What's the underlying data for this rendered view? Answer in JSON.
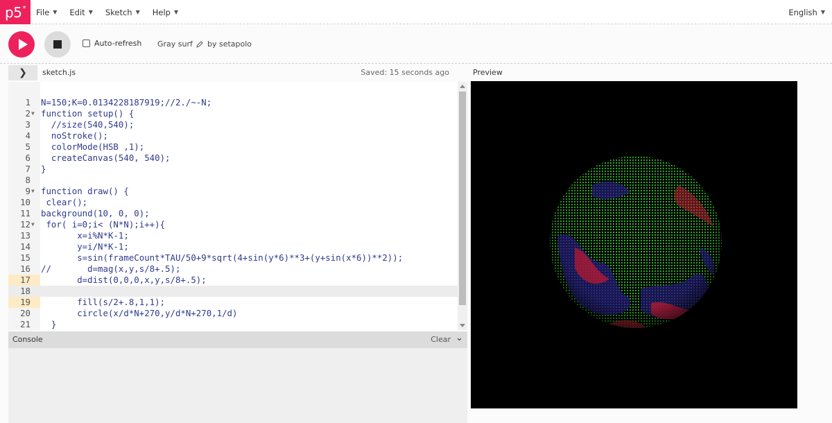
{
  "nav": {
    "logo": "p5",
    "menus": [
      {
        "label": "File"
      },
      {
        "label": "Edit"
      },
      {
        "label": "Sketch"
      },
      {
        "label": "Help"
      }
    ],
    "language": "English"
  },
  "toolbar": {
    "auto_refresh_label": "Auto-refresh",
    "sketch_name": "Gray surf",
    "byline": "by setapolo"
  },
  "editor": {
    "filename": "sketch.js",
    "saved_status": "Saved: 15 seconds ago",
    "lines": [
      "N=150;K=0.0134228187919;//2./~-N;",
      "function setup() {",
      "  //size(540,540);",
      "  noStroke();",
      "  colorMode(HSB ,1);",
      "  createCanvas(540, 540);",
      "}",
      "",
      "function draw() {",
      " clear();",
      "background(10, 0, 0);",
      " for( i=0;i< (N*N);i++){",
      "       x=i%N*K-1;",
      "       y=i/N*K-1;",
      "       s=sin(frameCount*TAU/50+9*sqrt(4+sin(y*6)**3+(y+sin(x*6))**2));",
      "//       d=mag(x,y,s/8+.5);",
      "       d=dist(0,0,0,x,y,s/8+.5);",
      "",
      "       fill(s/2+.8,1,1);",
      "       circle(x/d*N+270,y/d*N+270,1/d)",
      "  }"
    ]
  },
  "console": {
    "title": "Console",
    "clear_label": "Clear"
  },
  "preview": {
    "label": "Preview"
  },
  "colors": {
    "accent": "#ed225d",
    "canvas_bg": "#000000"
  }
}
